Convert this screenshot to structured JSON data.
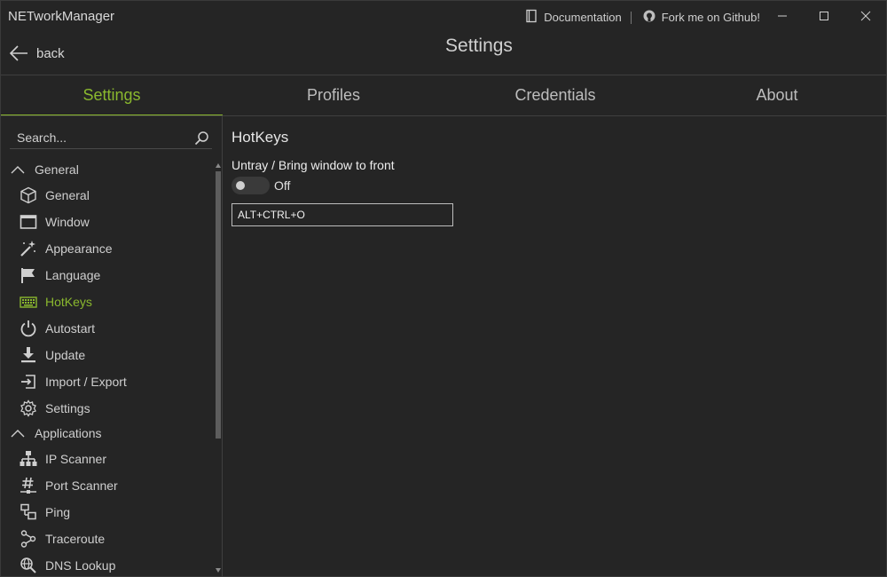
{
  "app": {
    "title": "NETworkManager"
  },
  "titlebar": {
    "documentation": "Documentation",
    "github": "Fork me on Github!"
  },
  "header": {
    "back": "back",
    "title": "Settings"
  },
  "tabs": [
    {
      "label": "Settings",
      "active": true
    },
    {
      "label": "Profiles"
    },
    {
      "label": "Credentials"
    },
    {
      "label": "About"
    }
  ],
  "sidebar": {
    "search_placeholder": "Search...",
    "groups": [
      {
        "label": "General",
        "items": [
          {
            "label": "General",
            "icon": "cube-icon"
          },
          {
            "label": "Window",
            "icon": "window-icon"
          },
          {
            "label": "Appearance",
            "icon": "magic-wand-icon"
          },
          {
            "label": "Language",
            "icon": "flag-icon"
          },
          {
            "label": "HotKeys",
            "icon": "keyboard-icon",
            "active": true
          },
          {
            "label": "Autostart",
            "icon": "power-icon"
          },
          {
            "label": "Update",
            "icon": "download-icon"
          },
          {
            "label": "Import / Export",
            "icon": "import-icon"
          },
          {
            "label": "Settings",
            "icon": "gear-icon"
          }
        ]
      },
      {
        "label": "Applications",
        "items": [
          {
            "label": "IP Scanner",
            "icon": "network-tree-icon"
          },
          {
            "label": "Port Scanner",
            "icon": "hash-icon"
          },
          {
            "label": "Ping",
            "icon": "ping-icon"
          },
          {
            "label": "Traceroute",
            "icon": "traceroute-icon"
          },
          {
            "label": "DNS Lookup",
            "icon": "dns-icon"
          }
        ]
      }
    ]
  },
  "content": {
    "section_title": "HotKeys",
    "setting_label": "Untray / Bring window to front",
    "toggle_state": "Off",
    "hotkey_value": "ALT+CTRL+O"
  },
  "colors": {
    "accent": "#8ab82e",
    "background": "#252525"
  }
}
